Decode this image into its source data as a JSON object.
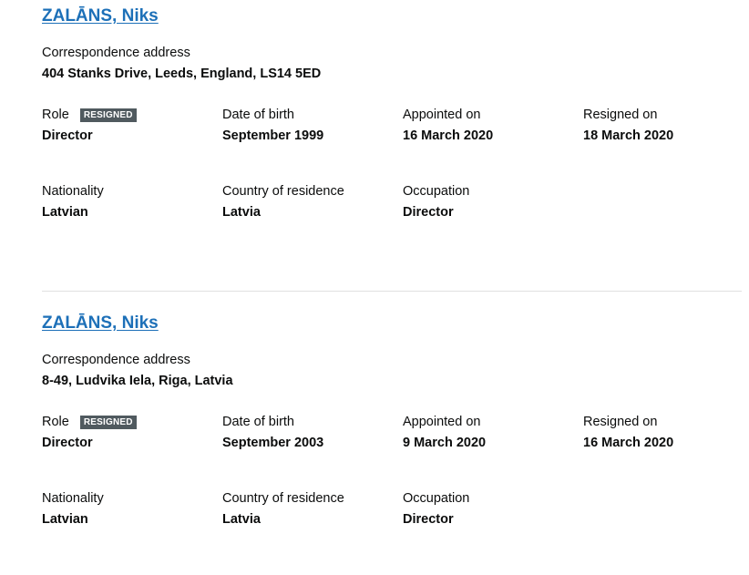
{
  "officers": [
    {
      "name": "ZALĀNS, Niks",
      "address_label": "Correspondence address",
      "address": "404 Stanks Drive, Leeds, England, LS14 5ED",
      "role_label": "Role",
      "role_badge": "RESIGNED",
      "role": "Director",
      "dob_label": "Date of birth",
      "dob": "September 1999",
      "appointed_label": "Appointed on",
      "appointed": "16 March 2020",
      "resigned_label": "Resigned on",
      "resigned": "18 March 2020",
      "nationality_label": "Nationality",
      "nationality": "Latvian",
      "residence_label": "Country of residence",
      "residence": "Latvia",
      "occupation_label": "Occupation",
      "occupation": "Director"
    },
    {
      "name": "ZALĀNS, Niks",
      "address_label": "Correspondence address",
      "address": "8-49, Ludvika Iela, Riga, Latvia",
      "role_label": "Role",
      "role_badge": "RESIGNED",
      "role": "Director",
      "dob_label": "Date of birth",
      "dob": "September 2003",
      "appointed_label": "Appointed on",
      "appointed": "9 March 2020",
      "resigned_label": "Resigned on",
      "resigned": "16 March 2020",
      "nationality_label": "Nationality",
      "nationality": "Latvian",
      "residence_label": "Country of residence",
      "residence": "Latvia",
      "occupation_label": "Occupation",
      "occupation": "Director"
    }
  ],
  "colors": {
    "link": "#1d70b8",
    "text": "#0b0c0c",
    "badge_bg": "#505a5f",
    "divider": "#e0e0e0"
  }
}
